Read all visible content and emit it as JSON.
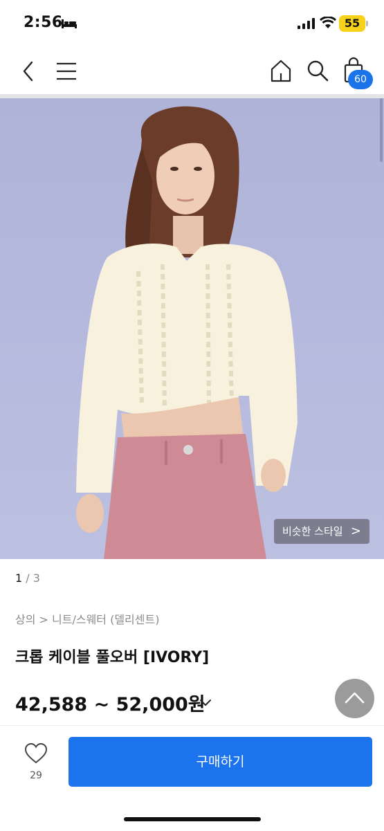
{
  "status_bar": {
    "time": "2:56",
    "battery": "55"
  },
  "header": {
    "cart_count": "60"
  },
  "hero": {
    "similar_style_label": "비슷한 스타일",
    "similar_style_chevron": ">"
  },
  "pager": {
    "current": "1",
    "separator": "/",
    "total": "3"
  },
  "product": {
    "breadcrumb": "상의 > 니트/스웨터 (델리센트)",
    "title": "크롭 케이블 풀오버 [IVORY]",
    "price_range": "42,588 ~ 52,000원"
  },
  "bottom_bar": {
    "like_count": "29",
    "buy_label": "구매하기"
  },
  "colors": {
    "accent": "#1b74ee",
    "battery": "#f7d21a",
    "badge": "#1a73e8"
  }
}
